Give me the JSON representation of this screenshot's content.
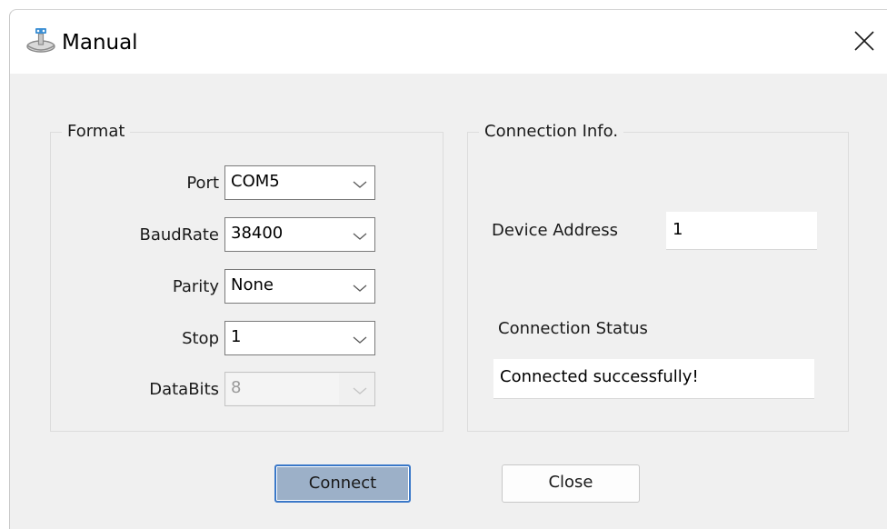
{
  "window": {
    "title": "Manual",
    "app_icon": "router-device-icon",
    "close_icon": "close-icon"
  },
  "format_group": {
    "legend": "Format",
    "fields": {
      "port": {
        "label": "Port",
        "value": "COM5",
        "enabled": true
      },
      "baudrate": {
        "label": "BaudRate",
        "value": "38400",
        "enabled": true
      },
      "parity": {
        "label": "Parity",
        "value": "None",
        "enabled": true
      },
      "stop": {
        "label": "Stop",
        "value": "1",
        "enabled": true
      },
      "databits": {
        "label": "DataBits",
        "value": "8",
        "enabled": false
      }
    }
  },
  "connection_group": {
    "legend": "Connection Info.",
    "device_address": {
      "label": "Device Address",
      "value": "1"
    },
    "connection_status": {
      "label": "Connection Status",
      "value": "Connected successfully!"
    }
  },
  "buttons": {
    "connect_label": "Connect",
    "close_label": "Close"
  },
  "colors": {
    "primary_button_fill": "#9cb0c8",
    "primary_button_border": "#3a78c8",
    "window_background": "#f0f0f0"
  }
}
